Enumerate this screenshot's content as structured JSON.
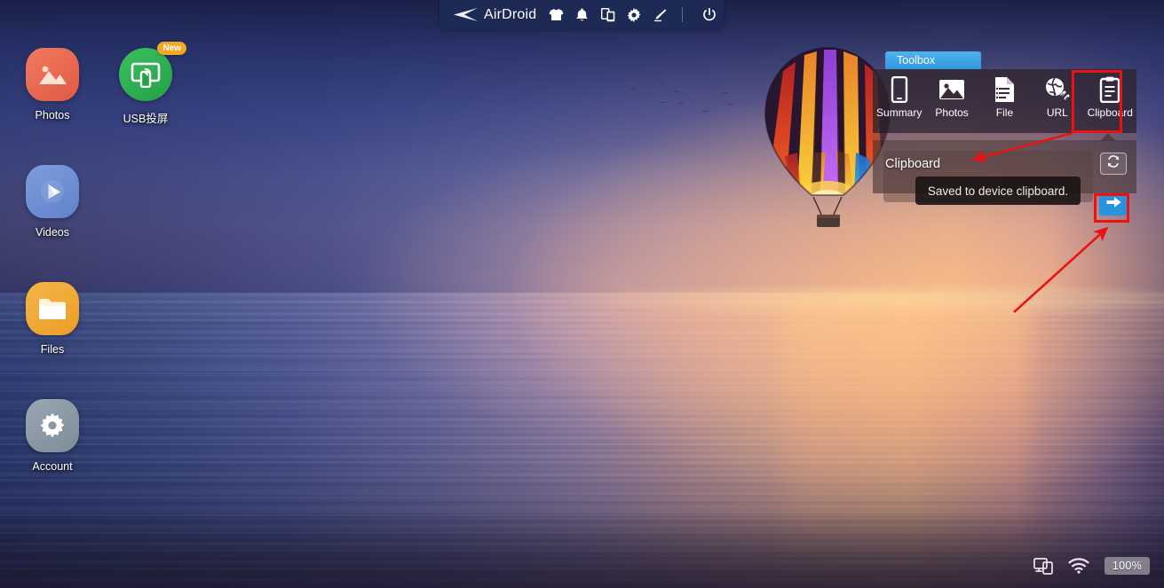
{
  "topnav": {
    "brand_name": "AirDroid",
    "logo_icon": "airdroid-paper-plane-logo",
    "icons": [
      {
        "name": "tshirt-icon",
        "label": "Theme"
      },
      {
        "name": "bell-icon",
        "label": "Notifications"
      },
      {
        "name": "devices-icon",
        "label": "Devices"
      },
      {
        "name": "gear-icon",
        "label": "Settings"
      },
      {
        "name": "pen-icon",
        "label": "Edit"
      },
      {
        "name": "power-icon",
        "label": "Power"
      }
    ]
  },
  "desktop": {
    "icons": [
      {
        "label": "Photos",
        "icon": "photos-icon",
        "color": "#ec6a52",
        "badge": null
      },
      {
        "label": "USB投屏",
        "icon": "usb-cast-icon",
        "color": "#2fae52",
        "badge": "New"
      },
      {
        "label": "Videos",
        "icon": "videos-icon",
        "color": "#6e8fd4",
        "badge": null
      },
      {
        "label": "Files",
        "icon": "files-icon",
        "color": "#f0a936",
        "badge": null
      },
      {
        "label": "Account",
        "icon": "account-icon",
        "color": "#8b99a5",
        "badge": null
      }
    ]
  },
  "toolbox": {
    "tab_label": "Toolbox",
    "tab_color": "#3ea5e8",
    "items": [
      {
        "label": "Summary",
        "icon": "phone-icon"
      },
      {
        "label": "Photos",
        "icon": "image-icon"
      },
      {
        "label": "File",
        "icon": "document-icon"
      },
      {
        "label": "URL",
        "icon": "globe-link-icon"
      },
      {
        "label": "Clipboard",
        "icon": "clipboard-icon"
      }
    ],
    "selected": "Clipboard",
    "highlight_color": "#ef1010"
  },
  "clipboard": {
    "title": "Clipboard",
    "input_value": "",
    "input_placeholder": "",
    "toast_message": "Saved to device clipboard.",
    "refresh_icon": "refresh-icon",
    "send_icon": "arrow-right-icon",
    "send_button_color": "#2a93e0"
  },
  "statusbar": {
    "screencast_icon": "screen-mirror-icon",
    "wifi_icon": "wifi-icon",
    "battery_label": "100%"
  },
  "wallpaper": {
    "description": "hot-air-balloon-over-sunset-sea"
  }
}
